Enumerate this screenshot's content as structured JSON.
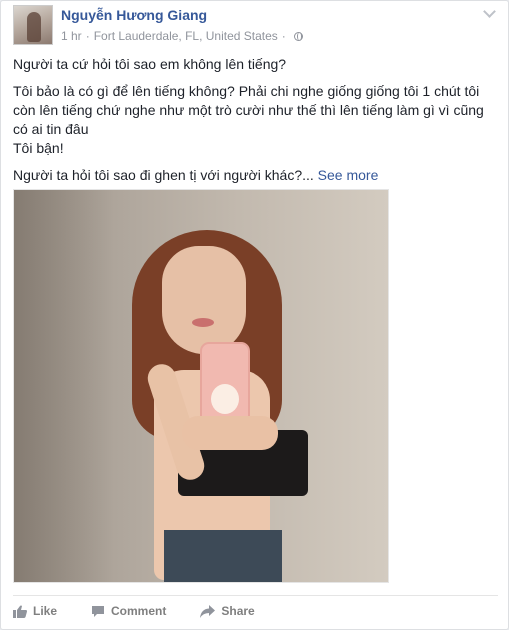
{
  "post": {
    "author": "Nguyễn Hương Giang",
    "time": "1 hr",
    "location": "Fort Lauderdale, FL, United States",
    "paragraphs": [
      "Người ta cứ hỏi tôi sao em không lên tiếng?",
      "Tôi bảo là có gì để lên tiếng không? Phải chi nghe giống giống tôi 1 chút tôi",
      "còn lên tiếng chứ nghe như một trò cười như thế thì lên tiếng làm gì vì cũng",
      "có ai tin đâu",
      "Tôi bận!"
    ],
    "teaser": "Người ta hỏi tôi sao đi ghen tị với người khác?...",
    "see_more": "See more"
  },
  "actions": {
    "like": "Like",
    "comment": "Comment",
    "share": "Share"
  },
  "icons": {
    "privacy": "globe-icon",
    "menu": "chevron-down-icon",
    "like": "thumbs-up-icon",
    "comment": "comment-icon",
    "share": "share-arrow-icon"
  },
  "colors": {
    "link": "#365899",
    "meta": "#90949c",
    "text": "#1d2129",
    "action": "#7f7f7f"
  }
}
